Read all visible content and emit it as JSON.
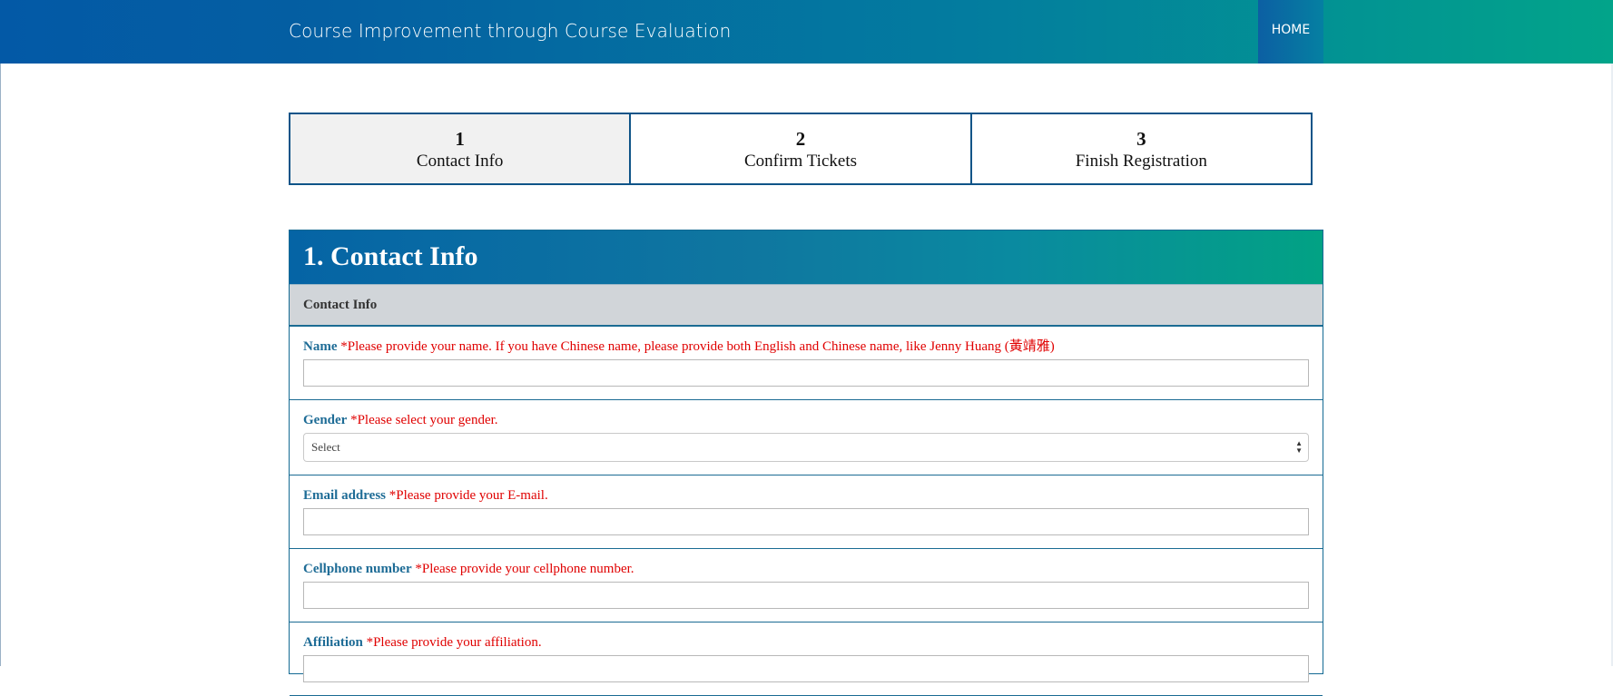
{
  "header": {
    "site_title": "Course Improvement through Course Evaluation",
    "nav_home": "HOME"
  },
  "steps": [
    {
      "number": "1",
      "label": "Contact Info",
      "active": true
    },
    {
      "number": "2",
      "label": "Confirm Tickets",
      "active": false
    },
    {
      "number": "3",
      "label": "Finish Registration",
      "active": false
    }
  ],
  "form": {
    "section_title": "1. Contact Info",
    "subsection_title": "Contact Info",
    "name": {
      "label": "Name",
      "hint": "*Please provide your name. If you have Chinese name, please provide both English and Chinese name, like Jenny Huang (黃靖雅)",
      "value": ""
    },
    "gender": {
      "label": "Gender",
      "hint": "*Please select your gender.",
      "selected": "Select"
    },
    "email": {
      "label": "Email address",
      "hint": "*Please provide your E-mail.",
      "value": ""
    },
    "cellphone": {
      "label": "Cellphone number",
      "hint": "*Please provide your cellphone number.",
      "value": ""
    },
    "affiliation": {
      "label": "Affiliation",
      "hint": "*Please provide your affiliation.",
      "value": ""
    }
  },
  "colors": {
    "brand_blue": "#0359a6",
    "brand_teal": "#02a48a",
    "label_blue": "#1e6c96",
    "hint_red": "#e00000"
  }
}
